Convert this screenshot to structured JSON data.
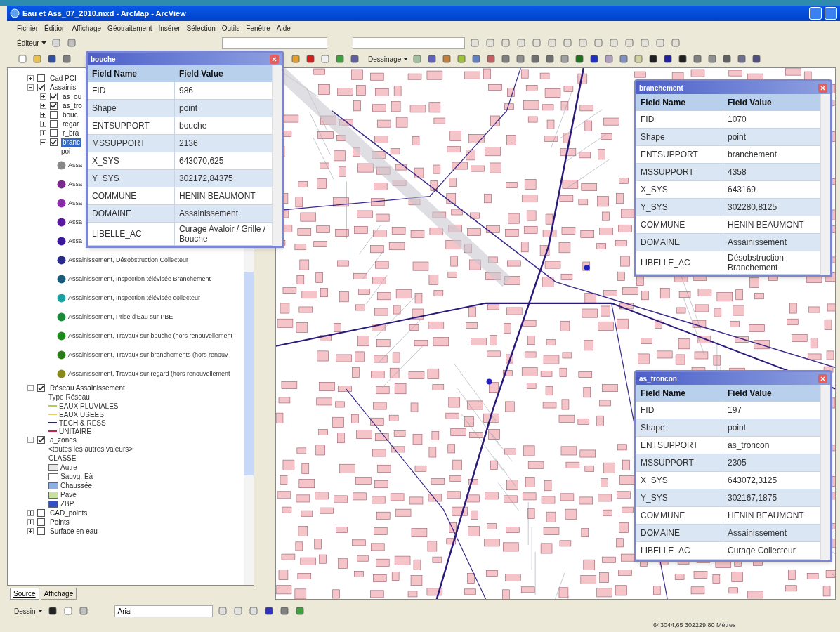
{
  "window": {
    "title": "Eau et Ass_07_2010.mxd - ArcMap - ArcView"
  },
  "menu": [
    "Fichier",
    "Édition",
    "Affichage",
    "Géotraitement",
    "Insérer",
    "Sélection",
    "Outils",
    "Fenêtre",
    "Aide"
  ],
  "editor_toolbar": {
    "label": "Éditeur"
  },
  "draw_toolbar": {
    "label": "Dessinage"
  },
  "toc": {
    "items": [
      {
        "kind": "layer",
        "label": "Cad PCI",
        "checked": false,
        "expanded": false,
        "selected": false
      },
      {
        "kind": "layer",
        "label": "Assainis",
        "checked": true,
        "expanded": true,
        "selected": false,
        "children": [
          {
            "kind": "layer",
            "label": "as_ou",
            "checked": true,
            "expanded": false,
            "selected": false
          },
          {
            "kind": "layer",
            "label": "as_tro",
            "checked": true,
            "expanded": false,
            "selected": false
          },
          {
            "kind": "layer",
            "label": "bouc",
            "checked": false,
            "expanded": false,
            "selected": false
          },
          {
            "kind": "layer",
            "label": "regar",
            "checked": false,
            "expanded": false,
            "selected": false
          },
          {
            "kind": "layer",
            "label": "r_bra",
            "checked": false,
            "expanded": false,
            "selected": false
          },
          {
            "kind": "layer",
            "label": "branc",
            "checked": true,
            "expanded": true,
            "selected": true,
            "children": [
              {
                "kind": "heading",
                "label": "poi"
              },
              {
                "kind": "class",
                "label": "Assa",
                "color": "#888888"
              },
              {
                "kind": "class",
                "label": "Assa",
                "color": "#7a2a8a"
              },
              {
                "kind": "class",
                "label": "Assa",
                "color": "#8a2aa8"
              },
              {
                "kind": "class",
                "label": "Assa",
                "color": "#5a1aa0"
              },
              {
                "kind": "class",
                "label": "Assa",
                "color": "#3a1a9a"
              },
              {
                "kind": "class",
                "label": "Assainissement, Désobstruction Collecteur",
                "color": "#2a2a8a"
              },
              {
                "kind": "class",
                "label": "Assainissement, Inspection télévisée Branchement",
                "color": "#1a5a7a"
              },
              {
                "kind": "class",
                "label": "Assainissement, Inspection télévisée collecteur",
                "color": "#1aa0a0"
              },
              {
                "kind": "class",
                "label": "Assainissement, Prise d'Eau sur PBE",
                "color": "#1a8a3a"
              },
              {
                "kind": "class",
                "label": "Assainissement, Travaux sur bouche (hors renouvellement",
                "color": "#1a8a1a"
              },
              {
                "kind": "class",
                "label": "Assainissement, Travaux sur branchements (hors renouv",
                "color": "#2a7a1a"
              },
              {
                "kind": "class",
                "label": "Assainissement, Travaux sur regard (hors renouvellement",
                "color": "#8a8a1a"
              }
            ]
          }
        ]
      },
      {
        "kind": "layer",
        "label": "Réseau Assainissement",
        "checked": true,
        "expanded": true,
        "selected": false,
        "children": [
          {
            "kind": "heading",
            "label": "Type Réseau"
          },
          {
            "kind": "line",
            "label": "EAUX PLUVIALES",
            "color": "#b8d040"
          },
          {
            "kind": "line",
            "label": "EAUX USEES",
            "color": "#e8d060"
          },
          {
            "kind": "line",
            "label": "TECH & RESS",
            "color": "#2020a0"
          },
          {
            "kind": "line",
            "label": "UNITAIRE",
            "color": "#d02040"
          }
        ]
      },
      {
        "kind": "layer",
        "label": "a_zones",
        "checked": true,
        "expanded": true,
        "selected": false,
        "children": [
          {
            "kind": "heading",
            "label": "<toutes les autres valeurs>"
          },
          {
            "kind": "heading",
            "label": "CLASSE"
          },
          {
            "kind": "fill",
            "label": "Autre",
            "color": "#e8e8e8"
          },
          {
            "kind": "fill",
            "label": "Sauvg. Eà",
            "color": "#ffffff"
          },
          {
            "kind": "fill",
            "label": "Chaussée",
            "color": "#8ab0e8"
          },
          {
            "kind": "fill",
            "label": "Pavé",
            "color": "#c8e0a0"
          },
          {
            "kind": "fill",
            "label": "ZBP",
            "color": "#3050c8"
          }
        ]
      },
      {
        "kind": "layer",
        "label": "CAD_points",
        "checked": false,
        "expanded": false,
        "selected": false
      },
      {
        "kind": "layer",
        "label": "Points",
        "checked": false,
        "expanded": false,
        "selected": false
      },
      {
        "kind": "layer",
        "label": "Surface en eau",
        "checked": false,
        "expanded": false,
        "selected": false
      }
    ]
  },
  "toc_tabs": [
    {
      "label": "Source",
      "selected": true
    },
    {
      "label": "Affichage",
      "selected": false
    }
  ],
  "popups": [
    {
      "title": "bouche",
      "columns": [
        "Field Name",
        "Field Value"
      ],
      "rows": [
        {
          "name": "FID",
          "value": "986"
        },
        {
          "name": "Shape",
          "value": "point"
        },
        {
          "name": "ENTSUPPORT",
          "value": "bouche"
        },
        {
          "name": "MSSUPPORT",
          "value": "2136"
        },
        {
          "name": "X_SYS",
          "value": "643070,625"
        },
        {
          "name": "Y_SYS",
          "value": "302172,84375"
        },
        {
          "name": "COMMUNE",
          "value": "HENIN BEAUMONT"
        },
        {
          "name": "DOMAINE",
          "value": "Assainissement"
        },
        {
          "name": "LIBELLE_AC",
          "value": "Curage Avaloir / Grille / Bouche"
        }
      ]
    },
    {
      "title": "branchement",
      "columns": [
        "Field Name",
        "Field Value"
      ],
      "rows": [
        {
          "name": "FID",
          "value": "1070"
        },
        {
          "name": "Shape",
          "value": "point"
        },
        {
          "name": "ENTSUPPORT",
          "value": "branchement"
        },
        {
          "name": "MSSUPPORT",
          "value": "4358"
        },
        {
          "name": "X_SYS",
          "value": "643169"
        },
        {
          "name": "Y_SYS",
          "value": "302280,8125"
        },
        {
          "name": "COMMUNE",
          "value": "HENIN BEAUMONT"
        },
        {
          "name": "DOMAINE",
          "value": "Assainissement"
        },
        {
          "name": "LIBELLE_AC",
          "value": "Désobstruction Branchement"
        }
      ]
    },
    {
      "title": "as_troncon",
      "columns": [
        "Field Name",
        "Field Value"
      ],
      "rows": [
        {
          "name": "FID",
          "value": "197"
        },
        {
          "name": "Shape",
          "value": "point"
        },
        {
          "name": "ENTSUPPORT",
          "value": "as_troncon"
        },
        {
          "name": "MSSUPPORT",
          "value": "2305"
        },
        {
          "name": "X_SYS",
          "value": "643072,3125"
        },
        {
          "name": "Y_SYS",
          "value": "302167,1875"
        },
        {
          "name": "COMMUNE",
          "value": "HENIN BEAUMONT"
        },
        {
          "name": "DOMAINE",
          "value": "Assainissement"
        },
        {
          "name": "LIBELLE_AC",
          "value": "Curage Collecteur"
        }
      ]
    }
  ],
  "bottom_toolbar": {
    "label": "Dessin",
    "font": "Arial"
  },
  "status_bar": {
    "coordinates": "643044,65  302229,80 Mètres"
  }
}
